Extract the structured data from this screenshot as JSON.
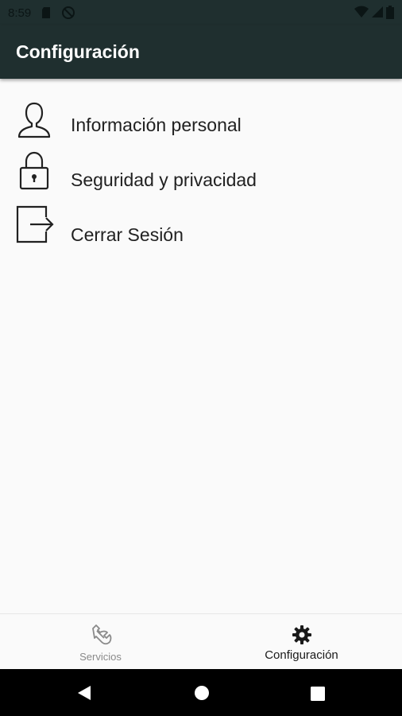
{
  "status_bar": {
    "time": "8:59",
    "icons": [
      "sd-card-icon",
      "no-disturb-icon",
      "wifi-icon",
      "signal-icon",
      "battery-icon"
    ]
  },
  "app_bar": {
    "title": "Configuración"
  },
  "menu": {
    "items": [
      {
        "label": "Información personal",
        "icon": "person-icon"
      },
      {
        "label": "Seguridad y privacidad",
        "icon": "lock-icon"
      },
      {
        "label": "Cerrar Sesión",
        "icon": "logout-icon"
      }
    ]
  },
  "bottom_nav": {
    "items": [
      {
        "label": "Servicios",
        "icon": "wrench-icon",
        "selected": false
      },
      {
        "label": "Configuración",
        "icon": "gear-icon",
        "selected": true
      }
    ]
  },
  "system_nav": {
    "buttons": [
      "back-icon",
      "home-icon",
      "recents-icon"
    ]
  },
  "colors": {
    "app_bar": "#1f2f2f",
    "background": "#fafafa",
    "nav_bar": "#000000"
  }
}
